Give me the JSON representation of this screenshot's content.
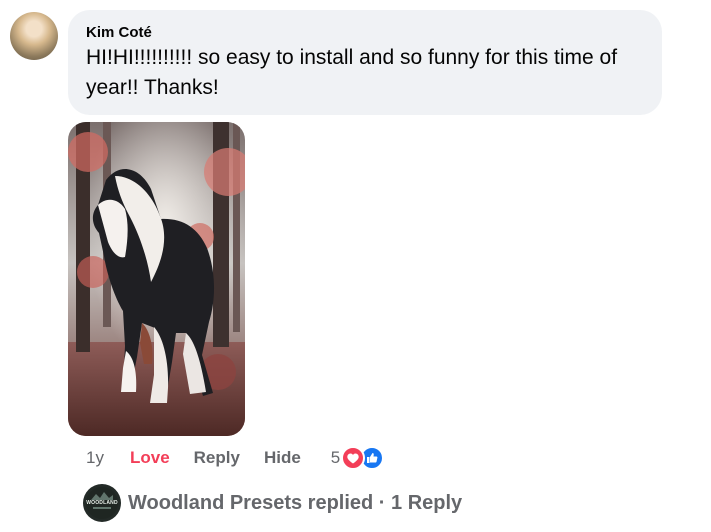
{
  "comment": {
    "author": "Kim Coté",
    "text": "HI!HI!!!!!!!!!! so easy to install and so funny for this time of year!! Thanks!"
  },
  "actions": {
    "time": "1y",
    "love": "Love",
    "reply": "Reply",
    "hide": "Hide",
    "reaction_count": "5"
  },
  "reply_summary": {
    "text": "Woodland Presets replied · 1 Reply",
    "avatar_label": "WOODLAND"
  },
  "icons": {
    "heart": "heart-icon",
    "like": "thumbs-up-icon"
  },
  "colors": {
    "love": "#f33e58",
    "like": "#1877f2",
    "muted": "#65676b",
    "bubble": "#f0f2f5"
  }
}
